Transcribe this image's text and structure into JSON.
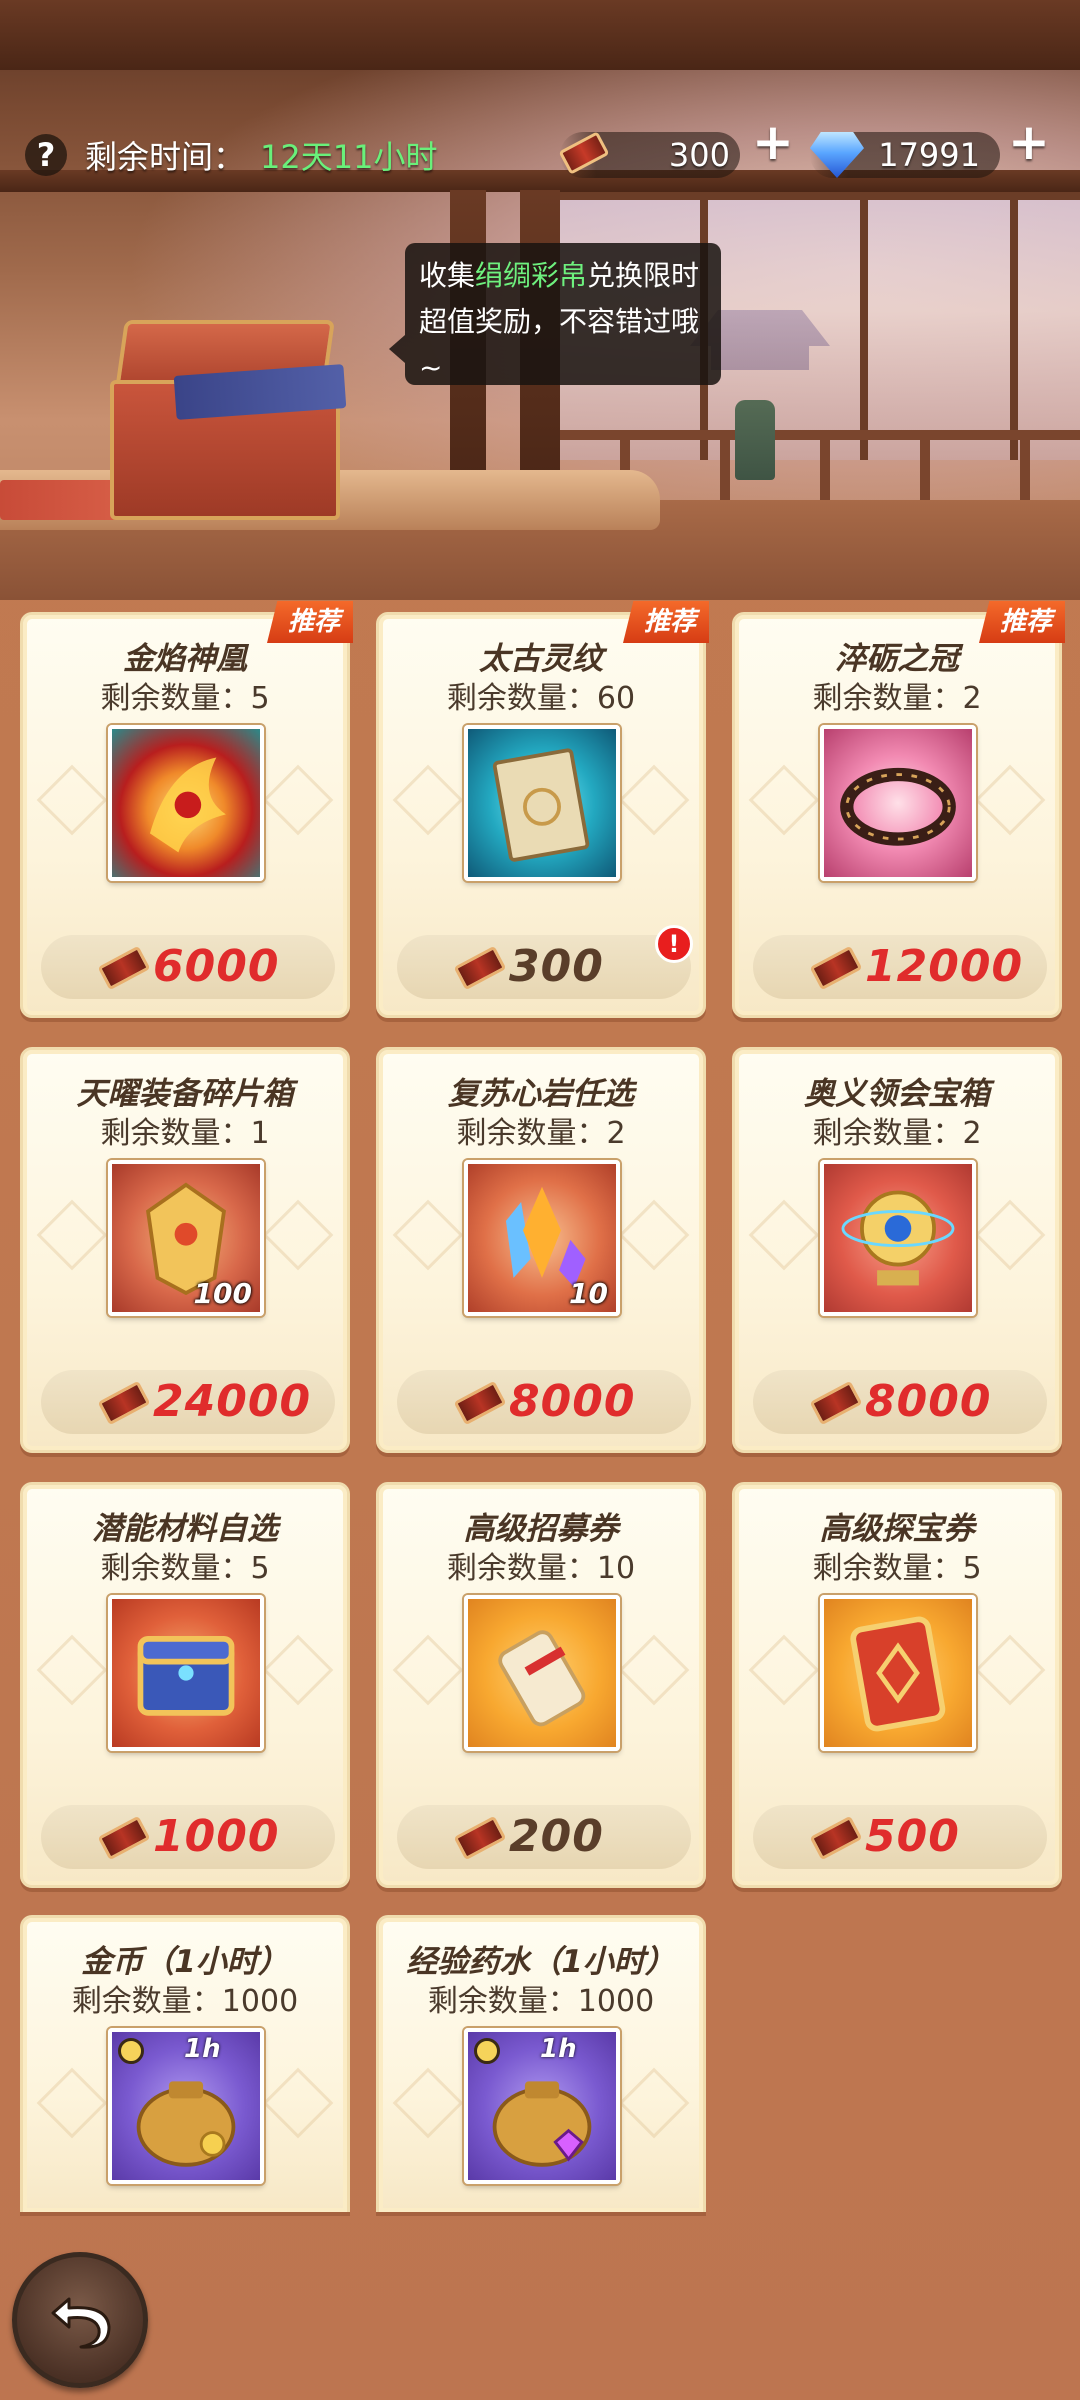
{
  "header": {
    "help_icon": "question-mark",
    "time_label": "剩余时间：",
    "time_value": "12天11小时",
    "currencies": [
      {
        "name": "silk-token",
        "icon": "silk-bolt-icon",
        "value": "300"
      },
      {
        "name": "diamond",
        "icon": "diamond-icon",
        "value": "17991"
      }
    ],
    "plus_symbol": "+"
  },
  "tooltip": {
    "part1": "收集",
    "highlight": "绢绸彩帛",
    "part2": "兑换限时超值奖励，不容错过哦~"
  },
  "cards": [
    {
      "title": "金焰神凰",
      "stock": "剩余数量：5",
      "price": "6000",
      "tag": "推荐",
      "icon": "golden-phoenix-icon",
      "price_color": "red"
    },
    {
      "title": "太古灵纹",
      "stock": "剩余数量：60",
      "price": "300",
      "tag": "推荐",
      "icon": "ancient-tome-icon",
      "price_color": "dark",
      "alert": "!"
    },
    {
      "title": "淬砺之冠",
      "stock": "剩余数量：2",
      "price": "12000",
      "tag": "推荐",
      "icon": "thorn-crown-icon",
      "price_color": "red"
    },
    {
      "title": "天曜装备碎片箱",
      "stock": "剩余数量：1",
      "price": "24000",
      "icon": "golden-armor-icon",
      "price_color": "red",
      "count": "100"
    },
    {
      "title": "复苏心岩任选",
      "stock": "剩余数量：2",
      "price": "8000",
      "icon": "crystal-shards-icon",
      "price_color": "red",
      "count": "10"
    },
    {
      "title": "奥义领会宝箱",
      "stock": "剩余数量：2",
      "price": "8000",
      "icon": "golden-orb-icon",
      "price_color": "red"
    },
    {
      "title": "潜能材料自选",
      "stock": "剩余数量：5",
      "price": "1000",
      "icon": "treasure-chest-icon",
      "price_color": "red"
    },
    {
      "title": "高级招募券",
      "stock": "剩余数量：10",
      "price": "200",
      "icon": "scroll-icon",
      "price_color": "dark"
    },
    {
      "title": "高级探宝券",
      "stock": "剩余数量：5",
      "price": "500",
      "icon": "red-card-icon",
      "price_color": "red"
    },
    {
      "title": "金币（1小时）",
      "stock": "剩余数量：1000",
      "icon": "gold-coin-bag-icon",
      "time": "1h"
    },
    {
      "title": "经验药水（1小时）",
      "stock": "剩余数量：1000",
      "icon": "exp-potion-bag-icon",
      "time": "1h"
    }
  ],
  "colors": {
    "price_red": "#e02c2c",
    "time_green": "#69f07a",
    "tag_orange": "#e4501e",
    "background": "#c27a52"
  },
  "back_button": {
    "icon": "back-arrow-icon"
  }
}
